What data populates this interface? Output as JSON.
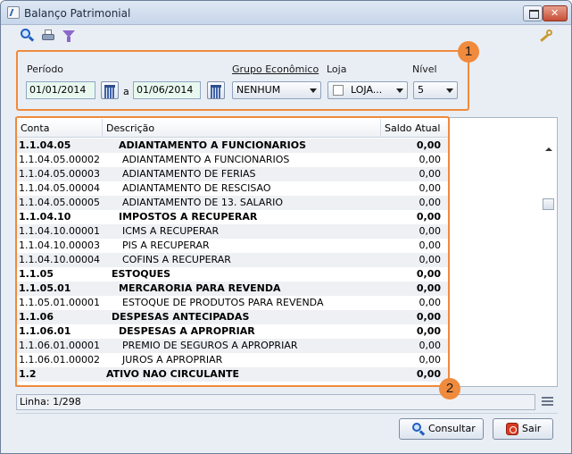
{
  "window": {
    "title": "Balanço Patrimonial"
  },
  "filters": {
    "periodo_label": "Período",
    "date_from": "01/01/2014",
    "date_sep": "a",
    "date_to": "01/06/2014",
    "grupo_label": "Grupo Econômico",
    "grupo_value": "NENHUM",
    "loja_label": "Loja",
    "loja_value": "LOJA...",
    "nivel_label": "Nível",
    "nivel_value": "5"
  },
  "grid": {
    "columns": [
      "Conta",
      "Descrição",
      "Saldo Atual"
    ],
    "rows": [
      {
        "conta": "1.1.04.05",
        "descricao": "ADIANTAMENTO A FUNCIONARIOS",
        "saldo": "0,00",
        "bold": true,
        "indent": 2
      },
      {
        "conta": "1.1.04.05.00002",
        "descricao": "ADIANTAMENTO A FUNCIONARIOS",
        "saldo": "0,00",
        "bold": false,
        "indent": 3
      },
      {
        "conta": "1.1.04.05.00003",
        "descricao": "ADIANTAMENTO DE FERIAS",
        "saldo": "0,00",
        "bold": false,
        "indent": 3
      },
      {
        "conta": "1.1.04.05.00004",
        "descricao": "ADIANTAMENTO DE RESCISAO",
        "saldo": "0,00",
        "bold": false,
        "indent": 3
      },
      {
        "conta": "1.1.04.05.00005",
        "descricao": "ADIANTAMENTO DE 13. SALARIO",
        "saldo": "0,00",
        "bold": false,
        "indent": 3
      },
      {
        "conta": "1.1.04.10",
        "descricao": "IMPOSTOS A RECUPERAR",
        "saldo": "0,00",
        "bold": true,
        "indent": 2
      },
      {
        "conta": "1.1.04.10.00001",
        "descricao": "ICMS A RECUPERAR",
        "saldo": "0,00",
        "bold": false,
        "indent": 3
      },
      {
        "conta": "1.1.04.10.00003",
        "descricao": "PIS A RECUPERAR",
        "saldo": "0,00",
        "bold": false,
        "indent": 3
      },
      {
        "conta": "1.1.04.10.00004",
        "descricao": "COFINS A RECUPERAR",
        "saldo": "0,00",
        "bold": false,
        "indent": 3
      },
      {
        "conta": "1.1.05",
        "descricao": "ESTOQUES",
        "saldo": "0,00",
        "bold": true,
        "indent": 1
      },
      {
        "conta": "1.1.05.01",
        "descricao": "MERCARORIA PARA REVENDA",
        "saldo": "0,00",
        "bold": true,
        "indent": 2
      },
      {
        "conta": "1.1.05.01.00001",
        "descricao": "ESTOQUE DE PRODUTOS PARA REVENDA",
        "saldo": "0,00",
        "bold": false,
        "indent": 3
      },
      {
        "conta": "1.1.06",
        "descricao": "DESPESAS ANTECIPADAS",
        "saldo": "0,00",
        "bold": true,
        "indent": 1
      },
      {
        "conta": "1.1.06.01",
        "descricao": "DESPESAS A APROPRIAR",
        "saldo": "0,00",
        "bold": true,
        "indent": 2
      },
      {
        "conta": "1.1.06.01.00001",
        "descricao": "PREMIO DE SEGUROS A APROPRIAR",
        "saldo": "0,00",
        "bold": false,
        "indent": 3
      },
      {
        "conta": "1.1.06.01.00002",
        "descricao": "JUROS A APROPRIAR",
        "saldo": "0,00",
        "bold": false,
        "indent": 3
      },
      {
        "conta": "1.2",
        "descricao": "ATIVO NAO CIRCULANTE",
        "saldo": "0,00",
        "bold": true,
        "indent": 0
      }
    ]
  },
  "status": {
    "text": "Linha: 1/298"
  },
  "buttons": {
    "consultar": "Consultar",
    "sair": "Sair"
  },
  "callouts": {
    "one": "1",
    "two": "2"
  },
  "colors": {
    "callout": "#f08a3c",
    "date_bg": "#e9f8ef",
    "exit": "#d83a22"
  },
  "icons": [
    "search-icon",
    "print-icon",
    "filter-icon",
    "key-icon",
    "calendar-icon",
    "menu-icon",
    "exit-icon"
  ]
}
